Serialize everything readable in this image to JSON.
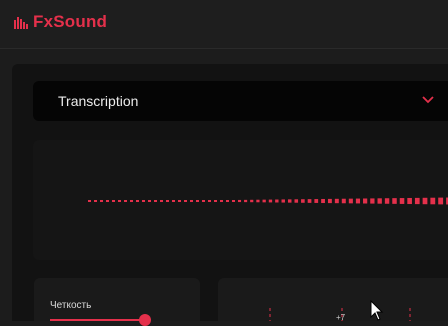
{
  "app": {
    "title": "FxSound",
    "brand_color": "#e4304b"
  },
  "preset": {
    "selected": "Transcription",
    "chevron_icon": "chevron-down-icon"
  },
  "visualizer": {
    "bar_color": "#e4304b"
  },
  "controls": {
    "clarity": {
      "label": "Четкость"
    }
  },
  "eq": {
    "band_gain_label": "+7"
  }
}
